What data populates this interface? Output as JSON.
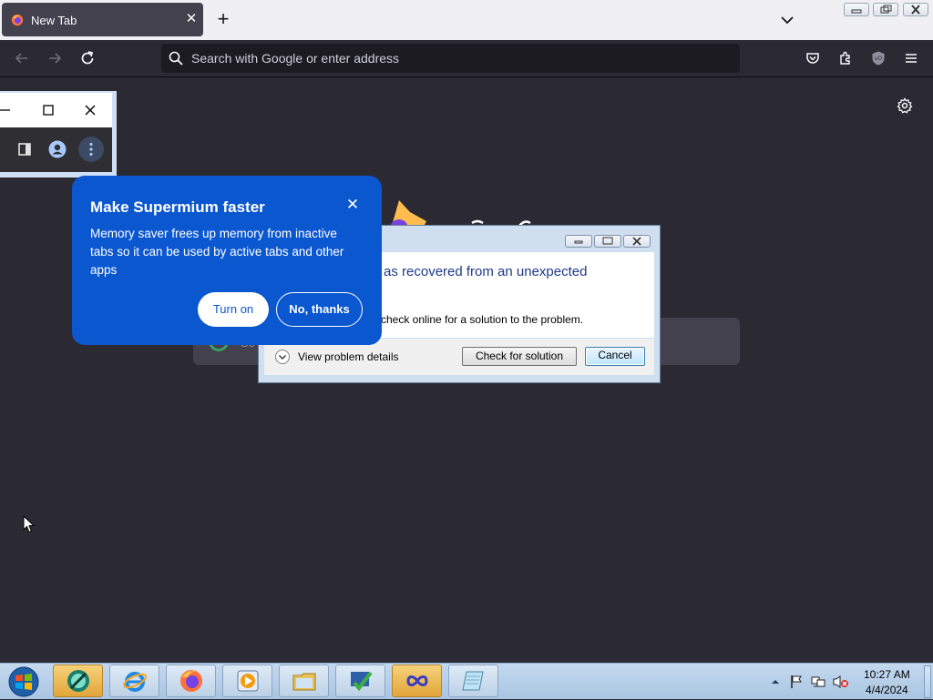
{
  "browser": {
    "tab": {
      "title": "New Tab"
    },
    "url_bar": {
      "placeholder": "Search with Google or enter address"
    }
  },
  "error_dialog": {
    "heading_fragment": "as recovered from an unexpected",
    "body_fragment": "check online for a solution to the problem.",
    "expander_label": "View problem details",
    "check_button": "Check for solution",
    "cancel_button": "Cancel"
  },
  "promo": {
    "title": "Make Supermium faster",
    "body": "Memory saver frees up memory from inactive tabs so it can be used by active tabs and other apps",
    "turn_on_button": "Turn on",
    "no_thanks_button": "No, thanks",
    "close_icon": "close-icon"
  },
  "background_search": {
    "text_fragment": "Se"
  },
  "taskbar": {
    "items": [
      {
        "name": "connection-app"
      },
      {
        "name": "internet-explorer"
      },
      {
        "name": "firefox"
      },
      {
        "name": "media-player"
      },
      {
        "name": "file-explorer"
      },
      {
        "name": "checker-app"
      },
      {
        "name": "infinity-app"
      },
      {
        "name": "notepad"
      }
    ],
    "clock": {
      "time": "10:27 AM",
      "date": "4/4/2024"
    }
  },
  "colors": {
    "promo_bg": "#0b57d0",
    "browser_bg": "#2b2a33",
    "taskbar_bg": "#b8d0ea"
  }
}
